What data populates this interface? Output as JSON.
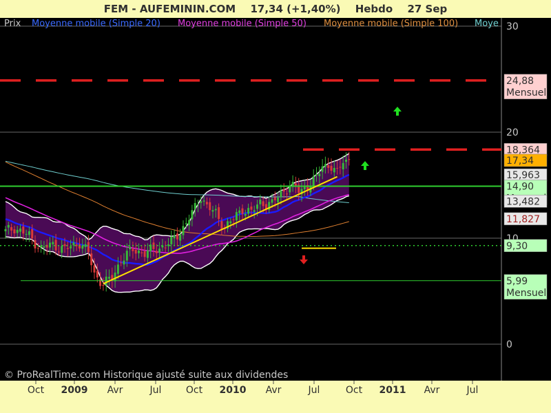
{
  "header": {
    "symbol": "FEM - AUFEMININ.COM",
    "quote": "17,34 (+1,40%)",
    "period": "Hebdo",
    "date": "27 Sep"
  },
  "legend": {
    "price": "Prix",
    "ma20": "Moyenne mobile (Simple 20)",
    "ma50": "Moyenne mobile (Simple 50)",
    "ma100": "Moyenne mobile (Simple 100)",
    "ma_cut": "Moye"
  },
  "footer": "© ProRealTime.com Historique ajusté suite aux dividendes",
  "colors": {
    "background": "#000000",
    "band_fill": "#4a0a55",
    "band_line": "#ffffff",
    "ma20": "#1a1aff",
    "ma50": "#e020e0",
    "ma100": "#e08030",
    "ma200": "#70d0d0",
    "up_candle": "#38b838",
    "down_candle": "#d83a3a",
    "trendline": "#ffe000",
    "resistance": "#e02020",
    "support": "#30d030"
  },
  "chart_data": {
    "type": "candlestick",
    "y_axis_ticks": [
      "0",
      "10",
      "20",
      "30"
    ],
    "ylim": [
      0,
      30
    ],
    "x_axis_labels": [
      "Oct",
      "2009",
      "Avr",
      "Jul",
      "Oct",
      "2010",
      "Avr",
      "Jul",
      "Oct",
      "2011",
      "Avr",
      "Jul"
    ],
    "levels": [
      {
        "value": 24.88,
        "label": "24,88",
        "tag": "Mensuel",
        "style": "red-dashed"
      },
      {
        "value": 18.36,
        "label": "18,364",
        "tag": "",
        "style": "red-dashed"
      },
      {
        "value": 17.34,
        "label": "17,34",
        "tag": "",
        "style": "last-price"
      },
      {
        "value": 15.963,
        "label": "15,963",
        "tag": "",
        "style": "hidden-label"
      },
      {
        "value": 14.9,
        "label": "14,90",
        "tag": "Mensuel",
        "style": "green-solid"
      },
      {
        "value": 13.482,
        "label": "13,482",
        "tag": "",
        "style": "hidden-label"
      },
      {
        "value": 11.827,
        "label": "11,827",
        "tag": "",
        "style": "ma-label"
      },
      {
        "value": 9.3,
        "label": "9,30",
        "tag": "",
        "style": "green-dotted"
      },
      {
        "value": 5.99,
        "label": "5,99",
        "tag": "Mensuel",
        "style": "green-solid"
      }
    ],
    "series": [
      {
        "name": "Moyenne mobile (Simple 20)"
      },
      {
        "name": "Moyenne mobile (Simple 50)"
      },
      {
        "name": "Moyenne mobile (Simple 100)"
      }
    ],
    "last_price": 17.34,
    "change_pct": 1.4
  }
}
